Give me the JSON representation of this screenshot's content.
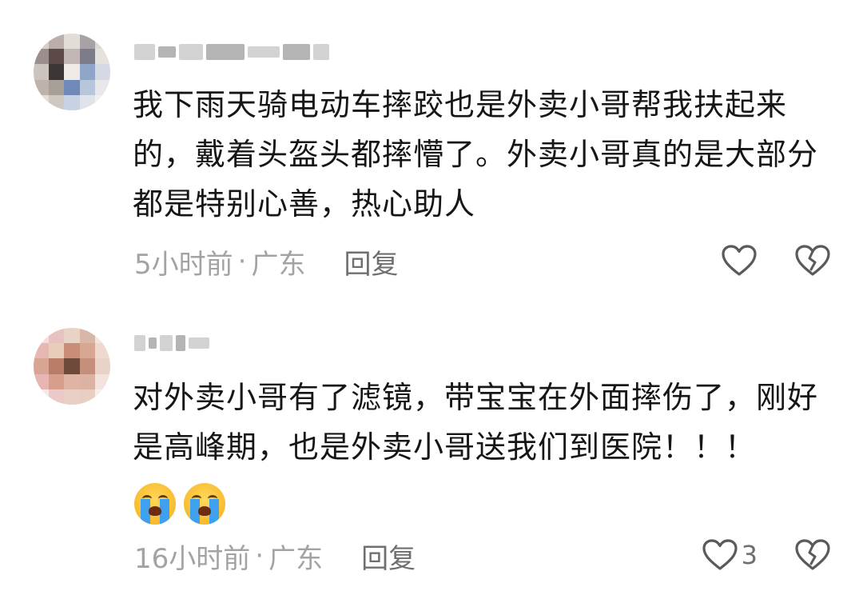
{
  "comments": [
    {
      "text": "我下雨天骑电动车摔跤也是外卖小哥帮我扶起来的，戴着头盔头都摔懵了。外卖小哥真的是大部分都是特别心善，热心助人",
      "time": "5小时前",
      "separator": "·",
      "location": "广东",
      "reply_label": "回复",
      "like_count": "",
      "avatar_colors": [
        "#d8cfc9",
        "#b9aea8",
        "#e3ddd8",
        "#a7a3a5",
        "#dcd7d2",
        "#9a8f8d",
        "#5c4a48",
        "#c2b6b4",
        "#7d7d8a",
        "#e5e2de",
        "#cbc3bd",
        "#3c3536",
        "#efeae6",
        "#8fa6c9",
        "#d4d9e4",
        "#bdb3ab",
        "#a89f99",
        "#6f8ab9",
        "#b8c6dc",
        "#e8e7ea",
        "#e4ddd7",
        "#cfc8c1",
        "#c8d2e3",
        "#dfe3ea",
        "#f1efef"
      ],
      "username_blocks": [
        26,
        22,
        30,
        48,
        40,
        34,
        20
      ]
    },
    {
      "text": "对外卖小哥有了滤镜，带宝宝在外面摔伤了，刚好是高峰期，也是外卖小哥送我们到医院！！！",
      "time": "16小时前",
      "separator": "·",
      "location": "广东",
      "reply_label": "回复",
      "like_count": "3",
      "avatar_colors": [
        "#f4dedd",
        "#e8c2c0",
        "#e7d4c6",
        "#d9b7a8",
        "#f1e6de",
        "#e6b8b1",
        "#e9cdbb",
        "#c98e78",
        "#d8a793",
        "#efd9cf",
        "#d8a595",
        "#b97c69",
        "#6e4a3a",
        "#c48f7b",
        "#e9d2c7",
        "#e8b6b2",
        "#d79e8c",
        "#e0b4a5",
        "#dcb3a3",
        "#f2e4dd",
        "#f5e8e6",
        "#ecc9c6",
        "#e9d0c7",
        "#e7cfc4",
        "#f7efec"
      ],
      "username_blocks": [
        14,
        10,
        16,
        12,
        26
      ],
      "emojis": [
        "loudly-crying-face",
        "loudly-crying-face"
      ]
    }
  ],
  "icons": {
    "like": "heart-outline-icon",
    "dislike": "broken-heart-outline-icon"
  },
  "colors": {
    "meta_text": "#a3a3a3",
    "reply_text": "#6f6f6f",
    "icon_stroke": "#5a5a5a"
  }
}
